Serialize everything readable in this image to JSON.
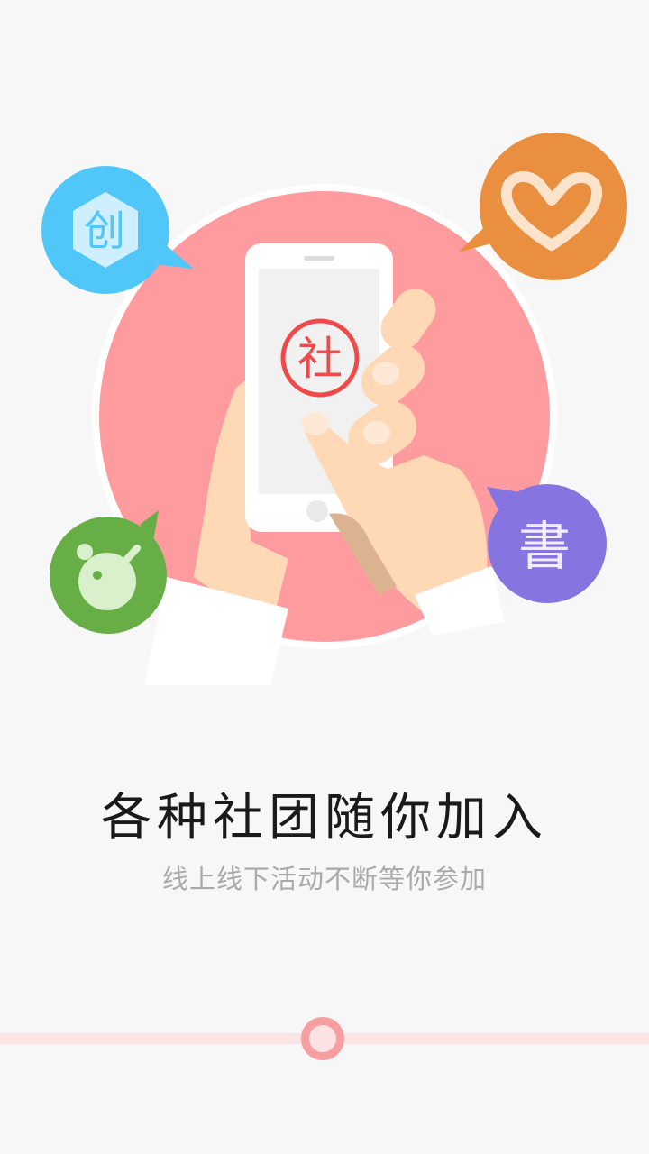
{
  "onboarding": {
    "title": "各种社团随你加入",
    "subtitle": "线上线下活动不断等你参加",
    "current_page": 1
  },
  "illustration": {
    "phone_badge": "社",
    "bubbles": [
      {
        "name": "create-bubble",
        "text": "创",
        "color": "#51c6f9"
      },
      {
        "name": "heart-bubble",
        "icon": "heart-icon",
        "color": "#ea8f40"
      },
      {
        "name": "pingpong-bubble",
        "icon": "ping-pong-icon",
        "color": "#66ae45"
      },
      {
        "name": "calligraphy-bubble",
        "text": "書",
        "color": "#8675e0"
      }
    ],
    "circle_color": "#fe9b9e"
  }
}
